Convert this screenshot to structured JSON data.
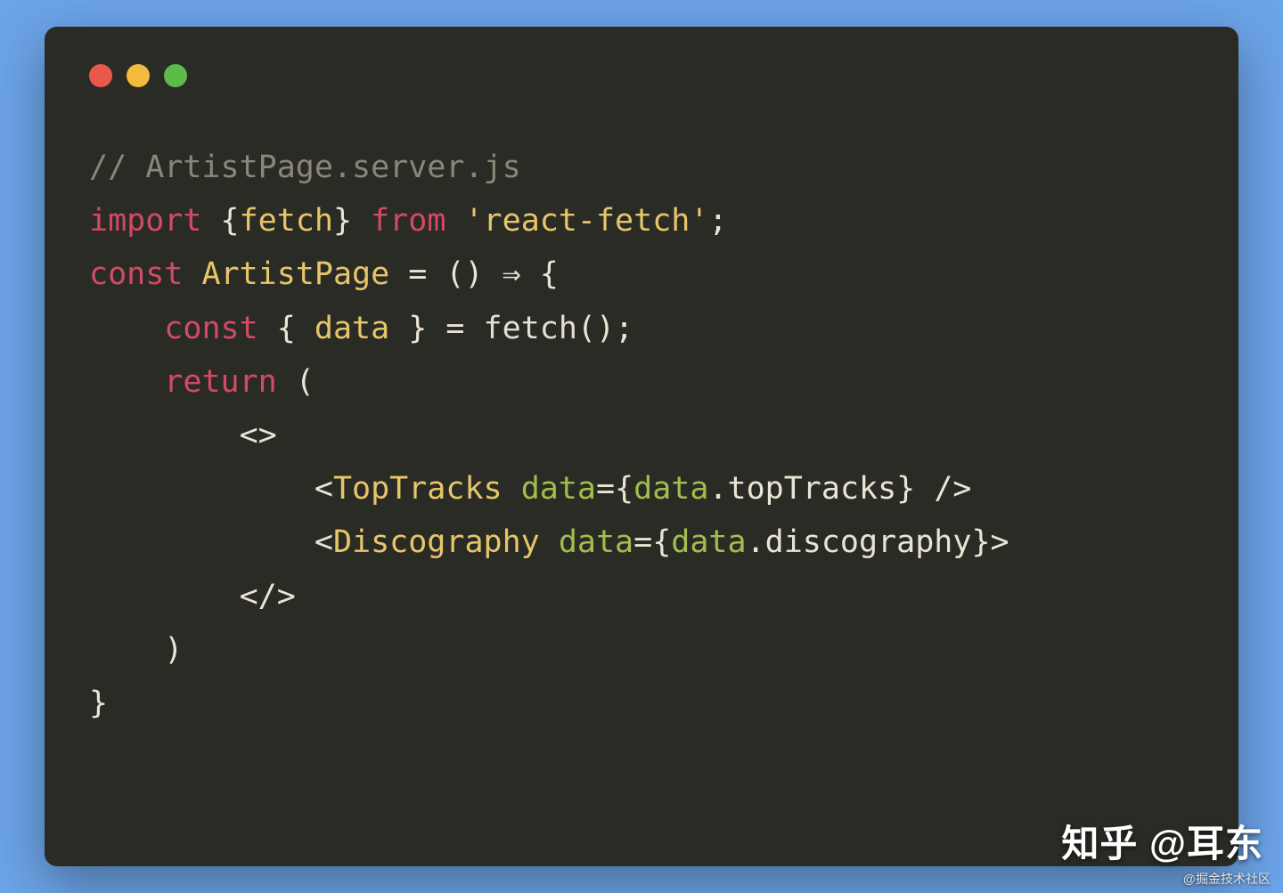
{
  "colors": {
    "page_bg": "#6ca4e8",
    "window_bg": "#2a2b25",
    "traffic_red": "#e9594b",
    "traffic_yellow": "#f3bb3d",
    "traffic_green": "#5ebb49",
    "comment": "#8a8778",
    "keyword": "#d34a63",
    "identifier": "#e7c66a",
    "attr": "#a2bd4f",
    "text": "#d8d2c2"
  },
  "code": {
    "l1_comment": "// ArtistPage.server.js",
    "l2": {
      "kw1": "import",
      "lb": " {",
      "id": "fetch",
      "rb": "} ",
      "kw2": "from",
      "sp": " ",
      "str": "'react-fetch'",
      "semi": ";"
    },
    "l3": {
      "kw": "const",
      "sp": " ",
      "id": "ArtistPage",
      "eq": " = () ",
      "arrow": "⇒",
      "ob": " {"
    },
    "l4": {
      "indent": "    ",
      "kw": "const",
      "lb": " { ",
      "id": "data",
      "rb": " } = ",
      "fn": "fetch",
      "call": "();"
    },
    "l5": {
      "indent": "    ",
      "kw": "return",
      "paren": " ("
    },
    "l6": {
      "indent": "        ",
      "open": "<>",
      "frag": ""
    },
    "l7": {
      "indent": "            ",
      "lt": "<",
      "tag": "TopTracks",
      "sp": " ",
      "attr": "data",
      "eq": "={",
      "obj": "data",
      "dot": ".topTracks} ",
      "close": "/>"
    },
    "l8": {
      "indent": "            ",
      "lt": "<",
      "tag": "Discography",
      "sp": " ",
      "attr": "data",
      "eq": "={",
      "obj": "data",
      "dot": ".discography}",
      "close": ">"
    },
    "l9": {
      "indent": "        ",
      "close": "</>"
    },
    "l10": {
      "indent": "    ",
      "paren": ")"
    },
    "l11": {
      "brace": "}"
    }
  },
  "watermark_main": "知乎 @耳东",
  "watermark_sub": "@掘金技术社区"
}
